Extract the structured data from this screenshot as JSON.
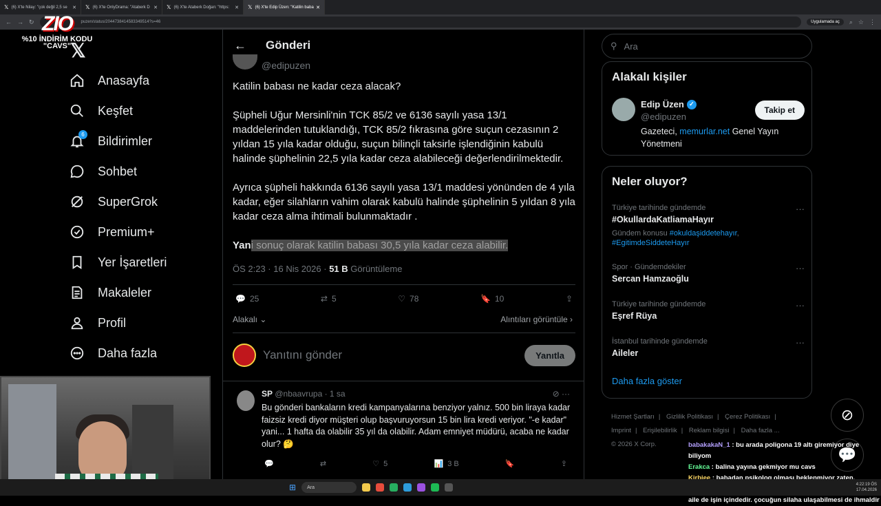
{
  "browser": {
    "tabs": [
      {
        "label": "(6) X'te Nilay: \"çok değil 2,5 se"
      },
      {
        "label": "(6) X'te OnlyDrama: \"Ataberk D"
      },
      {
        "label": "(6) X'te Ataberk Doğan: \"https:"
      },
      {
        "label": "(6) X'te Edip Üzen: \"Katilin baba"
      }
    ],
    "url": "puzen/status/2044738414583349514?s=46",
    "app_button": "Uygulamada aç"
  },
  "overlay": {
    "logo": "ZIO",
    "promo_line1": "%10 İNDİRİM KODU",
    "promo_line2": "\"CAVS\""
  },
  "sidebar": {
    "logo": "𝕏",
    "notification_count": "6",
    "items": [
      {
        "label": "Anasayfa",
        "icon": "home-icon"
      },
      {
        "label": "Keşfet",
        "icon": "search-icon"
      },
      {
        "label": "Bildirimler",
        "icon": "bell-icon"
      },
      {
        "label": "Sohbet",
        "icon": "chat-icon"
      },
      {
        "label": "SuperGrok",
        "icon": "grok-icon"
      },
      {
        "label": "Premium+",
        "icon": "premium-icon"
      },
      {
        "label": "Yer İşaretleri",
        "icon": "bookmark-icon"
      },
      {
        "label": "Makaleler",
        "icon": "article-icon"
      },
      {
        "label": "Profil",
        "icon": "profile-icon"
      },
      {
        "label": "Daha fazla",
        "icon": "more-icon"
      }
    ]
  },
  "post": {
    "header": "Gönderi",
    "handle": "@edipuzen",
    "p1": "Katilin babası ne kadar ceza alacak?",
    "p2": "Şüpheli Uğur Mersinli'nin TCK 85/2 ve 6136 sayılı yasa 13/1 maddelerinden tutuklandığı, TCK 85/2 fıkrasına göre suçun cezasının 2 yıldan 15 yıla kadar olduğu, suçun bilinçli taksirle işlendiğinin kabulü halinde şüphelinin 22,5 yıla kadar ceza alabileceği değerlendirilmektedir.",
    "p3": "Ayrıca şüpheli hakkında 6136 sayılı yasa 13/1 maddesi yönünden de 4 yıla kadar, eğer silahların vahim olarak kabulü halinde şüphelinin 5 yıldan 8 yıla kadar ceza alma ihtimali bulunmaktadır .",
    "p4_start": "Yan",
    "p4_highlighted": "i sonuç olarak katilin babası 30,5 yıla kadar ceza alabilir.",
    "time": "ÖS 2:23 · 16 Nis 2026 · ",
    "views": "51 B",
    "views_label": " Görüntüleme",
    "replies": "25",
    "reposts": "5",
    "likes": "78",
    "bookmarks": "10",
    "related_label": "Alakalı",
    "quotes_label": "Alıntıları görüntüle",
    "reply_placeholder": "Yanıtını gönder",
    "reply_button": "Yanıtla"
  },
  "comment": {
    "name": "SP",
    "handle": "@nbaavrupa · 1 sa",
    "text": "Bu gönderi bankaların kredi kampanyalarına benziyor yalnız. 500 bin liraya kadar faizsiz kredi diyor müşteri olup başvuruyorsun 15 bin lira kredi veriyor. \"-e kadar\" yani... 1 hafta da olabilir 35 yıl da olabilir. Adam emniyet müdürü, acaba ne kadar olur? 🤔",
    "likes": "5",
    "views": "3 B"
  },
  "right": {
    "search_placeholder": "Ara",
    "related_title": "Alakalı kişiler",
    "person": {
      "name": "Edip Üzen",
      "handle": "@edipuzen",
      "follow": "Takip et",
      "bio_start": "Gazeteci, ",
      "bio_link": "memurlar.net",
      "bio_end": " Genel Yayın Yönetmeni"
    },
    "trends_title": "Neler oluyor?",
    "trends": [
      {
        "cat": "Türkiye tarihinde gündemde",
        "name": "#OkullardaKatliamaHayır",
        "sub_label": "Gündem konusu ",
        "sub_link1": "#okuldaşiddetehayır",
        "sub_sep": ",",
        "sub_link2": "#EgitimdeSiddeteHayır"
      },
      {
        "cat": "Spor · Gündemdekiler",
        "name": "Sercan Hamzaoğlu"
      },
      {
        "cat": "Türkiye tarihinde gündemde",
        "name": "Eşref Rüya"
      },
      {
        "cat": "İstanbul tarihinde gündemde",
        "name": "Aileler"
      }
    ],
    "show_more": "Daha fazla göster",
    "footer": [
      "Hizmet Şartları",
      "|",
      "Gizlilik Politikası",
      "|",
      "Çerez Politikası",
      "|",
      "Imprint",
      "|",
      "Erişilebilirlik",
      "|",
      "Reklam bilgisi",
      "|",
      "Daha fazla ...",
      "© 2026 X Corp."
    ]
  },
  "chat": [
    {
      "user": "babakakaN_1",
      "msg": " : bu arada poligona 19 altı giremiyor diye biliyom"
    },
    {
      "user": "Erakca",
      "msg": " : balina yayına gekmiyor mu cavs"
    },
    {
      "user": "Kirbiee",
      "msg": " : babadan psikolog olması beklenmiyor zaten."
    },
    {
      "user": "",
      "msg": "psikolog çocukta tek başına çalışamaz hep aile ile çalışılır. aile de işin içindedir. çocuğun silaha ulaşabilmesi de ihmaldir"
    }
  ],
  "taskbar": {
    "search": "Ara",
    "time": "4:22:19 ÖS",
    "date": "17.04.2026"
  }
}
